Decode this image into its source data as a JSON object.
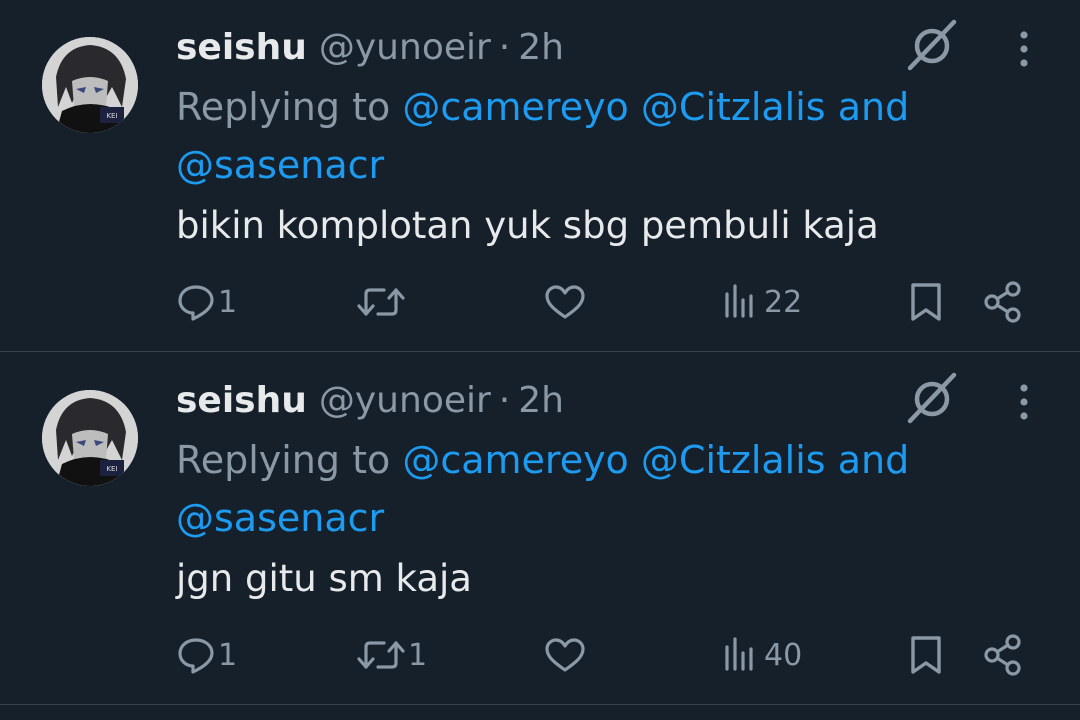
{
  "colors": {
    "background": "#15202b",
    "primary_text": "#e7e9ea",
    "secondary_text": "#8b98a5",
    "link": "#1d9bf0",
    "divider": "#38444d"
  },
  "tweets": [
    {
      "display_name": "seishu",
      "handle": "@yunoeir",
      "separator": "·",
      "time": "2h",
      "replying_prefix": "Replying to",
      "mention_1": "@camereyo",
      "mention_2": "@Citzlalis",
      "and": "and",
      "mention_3": "@sasenacr",
      "text": "bikin komplotan yuk sbg pembuli kaja",
      "replies": "1",
      "reposts": "",
      "views": "22",
      "icons": [
        "grok-icon",
        "more-icon",
        "reply-icon",
        "repost-icon",
        "like-icon",
        "views-icon",
        "bookmark-icon",
        "share-icon"
      ]
    },
    {
      "display_name": "seishu",
      "handle": "@yunoeir",
      "separator": "·",
      "time": "2h",
      "replying_prefix": "Replying to",
      "mention_1": "@camereyo",
      "mention_2": "@Citzlalis",
      "and": "and",
      "mention_3": "@sasenacr",
      "text": "jgn gitu sm kaja",
      "replies": "1",
      "reposts": "1",
      "views": "40",
      "icons": [
        "grok-icon",
        "more-icon",
        "reply-icon",
        "repost-icon",
        "like-icon",
        "views-icon",
        "bookmark-icon",
        "share-icon"
      ]
    }
  ]
}
